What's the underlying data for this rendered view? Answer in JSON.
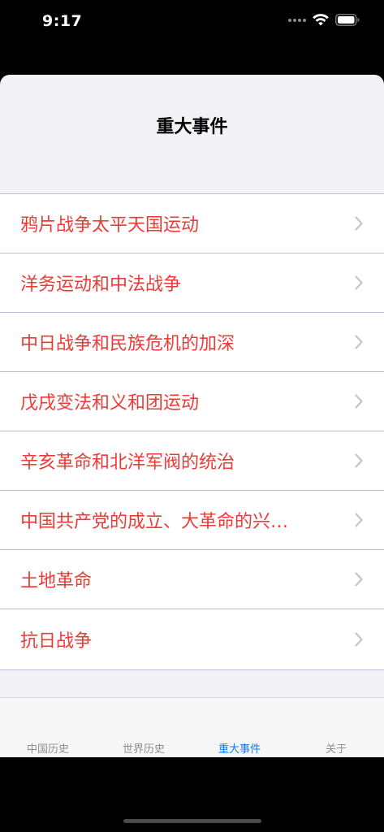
{
  "status_bar": {
    "time": "9:17"
  },
  "nav": {
    "title": "重大事件"
  },
  "list": {
    "items": [
      {
        "label": "鸦片战争太平天国运动"
      },
      {
        "label": "洋务运动和中法战争"
      },
      {
        "label": "中日战争和民族危机的加深"
      },
      {
        "label": "戊戌变法和义和团运动"
      },
      {
        "label": "辛亥革命和北洋军阀的统治"
      },
      {
        "label": "中国共产党的成立、大革命的兴…"
      },
      {
        "label": "土地革命"
      },
      {
        "label": "抗日战争"
      }
    ]
  },
  "tabs": [
    {
      "label": "中国历史"
    },
    {
      "label": "世界历史"
    },
    {
      "label": "重大事件"
    },
    {
      "label": "关于"
    }
  ],
  "colors": {
    "accent": "#0a7aff",
    "row_text": "#ee3a36",
    "separator": "#b6c0db"
  },
  "icons": {
    "row_disclosure": "chevron-right-icon",
    "wifi": "wifi-icon",
    "battery": "battery-icon",
    "cellular": "cellular-signal-icon"
  }
}
